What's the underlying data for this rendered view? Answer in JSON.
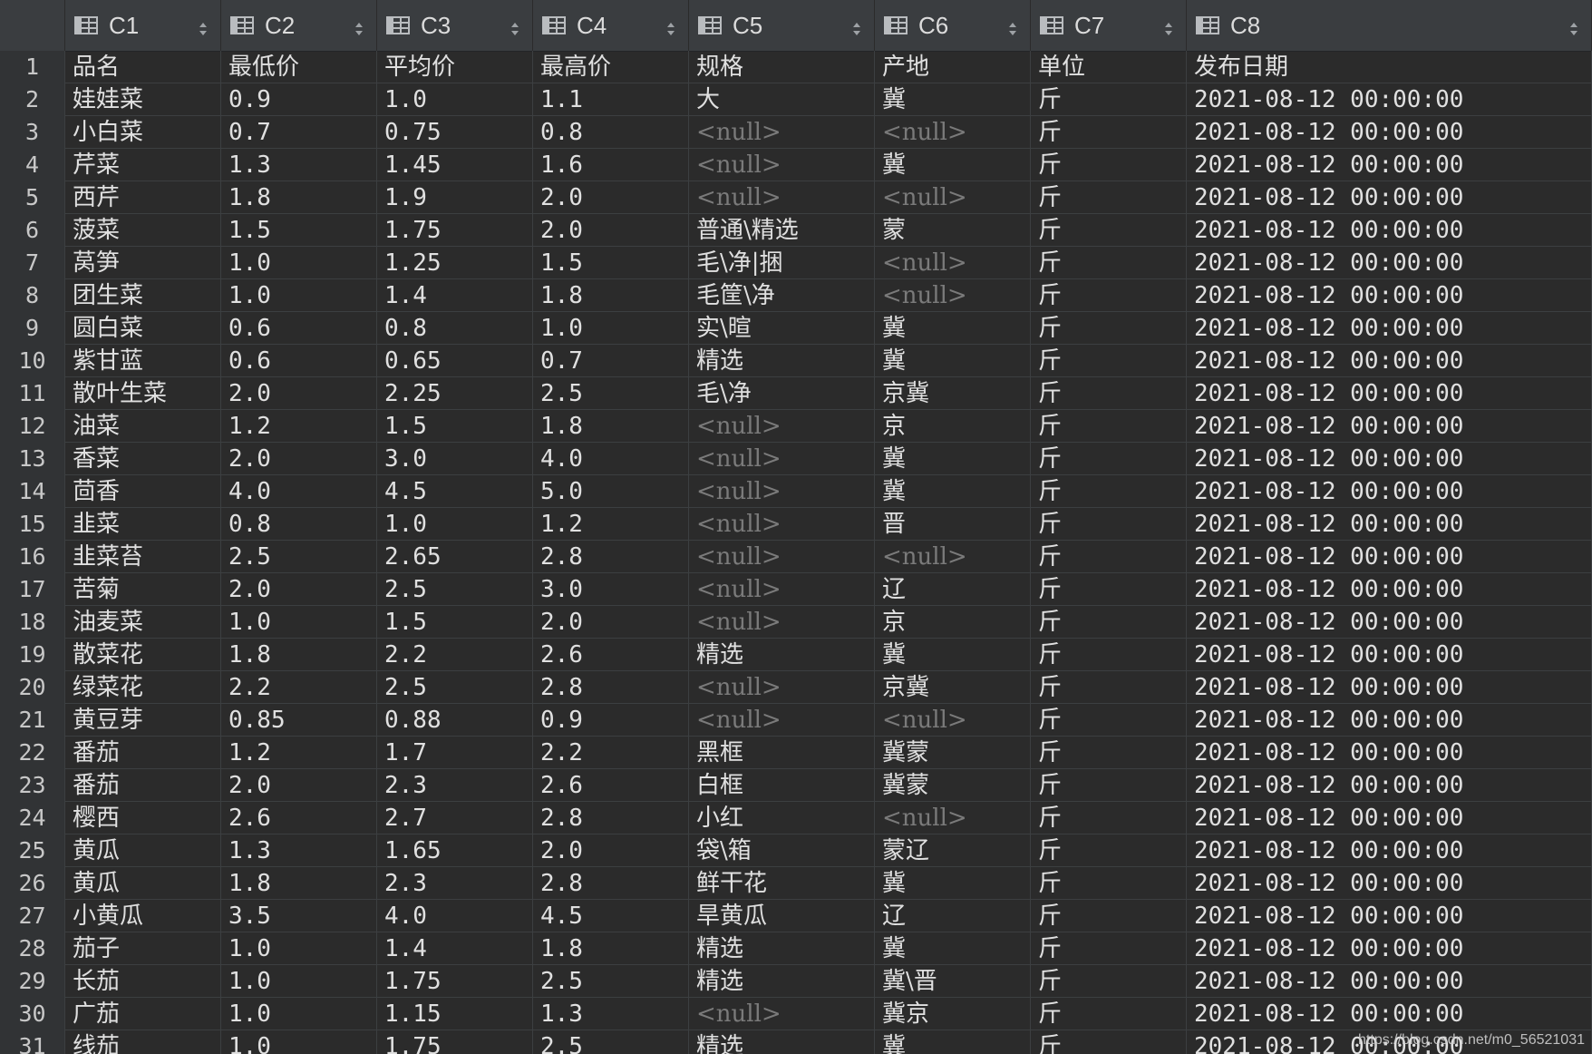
{
  "columns": [
    "C1",
    "C2",
    "C3",
    "C4",
    "C5",
    "C6",
    "C7",
    "C8"
  ],
  "null_text": "<null>",
  "rows": [
    [
      "1",
      "品名",
      "最低价",
      "平均价",
      "最高价",
      "规格",
      "产地",
      "单位",
      "发布日期"
    ],
    [
      "2",
      "娃娃菜",
      "0.9",
      "1.0",
      "1.1",
      "大",
      "冀",
      "斤",
      "2021-08-12 00:00:00"
    ],
    [
      "3",
      "小白菜",
      "0.7",
      "0.75",
      "0.8",
      null,
      null,
      "斤",
      "2021-08-12 00:00:00"
    ],
    [
      "4",
      "芹菜",
      "1.3",
      "1.45",
      "1.6",
      null,
      "冀",
      "斤",
      "2021-08-12 00:00:00"
    ],
    [
      "5",
      "西芹",
      "1.8",
      "1.9",
      "2.0",
      null,
      null,
      "斤",
      "2021-08-12 00:00:00"
    ],
    [
      "6",
      "菠菜",
      "1.5",
      "1.75",
      "2.0",
      "普通\\精选",
      "蒙",
      "斤",
      "2021-08-12 00:00:00"
    ],
    [
      "7",
      "莴笋",
      "1.0",
      "1.25",
      "1.5",
      "毛\\净|捆",
      null,
      "斤",
      "2021-08-12 00:00:00"
    ],
    [
      "8",
      "团生菜",
      "1.0",
      "1.4",
      "1.8",
      "毛筐\\净",
      null,
      "斤",
      "2021-08-12 00:00:00"
    ],
    [
      "9",
      "圆白菜",
      "0.6",
      "0.8",
      "1.0",
      "实\\暄",
      "冀",
      "斤",
      "2021-08-12 00:00:00"
    ],
    [
      "10",
      "紫甘蓝",
      "0.6",
      "0.65",
      "0.7",
      "精选",
      "冀",
      "斤",
      "2021-08-12 00:00:00"
    ],
    [
      "11",
      "散叶生菜",
      "2.0",
      "2.25",
      "2.5",
      "毛\\净",
      "京冀",
      "斤",
      "2021-08-12 00:00:00"
    ],
    [
      "12",
      "油菜",
      "1.2",
      "1.5",
      "1.8",
      null,
      "京",
      "斤",
      "2021-08-12 00:00:00"
    ],
    [
      "13",
      "香菜",
      "2.0",
      "3.0",
      "4.0",
      null,
      "冀",
      "斤",
      "2021-08-12 00:00:00"
    ],
    [
      "14",
      "茴香",
      "4.0",
      "4.5",
      "5.0",
      null,
      "冀",
      "斤",
      "2021-08-12 00:00:00"
    ],
    [
      "15",
      "韭菜",
      "0.8",
      "1.0",
      "1.2",
      null,
      "晋",
      "斤",
      "2021-08-12 00:00:00"
    ],
    [
      "16",
      "韭菜苔",
      "2.5",
      "2.65",
      "2.8",
      null,
      null,
      "斤",
      "2021-08-12 00:00:00"
    ],
    [
      "17",
      "苦菊",
      "2.0",
      "2.5",
      "3.0",
      null,
      "辽",
      "斤",
      "2021-08-12 00:00:00"
    ],
    [
      "18",
      "油麦菜",
      "1.0",
      "1.5",
      "2.0",
      null,
      "京",
      "斤",
      "2021-08-12 00:00:00"
    ],
    [
      "19",
      "散菜花",
      "1.8",
      "2.2",
      "2.6",
      "精选",
      "冀",
      "斤",
      "2021-08-12 00:00:00"
    ],
    [
      "20",
      "绿菜花",
      "2.2",
      "2.5",
      "2.8",
      null,
      "京冀",
      "斤",
      "2021-08-12 00:00:00"
    ],
    [
      "21",
      "黄豆芽",
      "0.85",
      "0.88",
      "0.9",
      null,
      null,
      "斤",
      "2021-08-12 00:00:00"
    ],
    [
      "22",
      "番茄",
      "1.2",
      "1.7",
      "2.2",
      "黑框",
      "冀蒙",
      "斤",
      "2021-08-12 00:00:00"
    ],
    [
      "23",
      "番茄",
      "2.0",
      "2.3",
      "2.6",
      "白框",
      "冀蒙",
      "斤",
      "2021-08-12 00:00:00"
    ],
    [
      "24",
      "樱西",
      "2.6",
      "2.7",
      "2.8",
      "小红",
      null,
      "斤",
      "2021-08-12 00:00:00"
    ],
    [
      "25",
      "黄瓜",
      "1.3",
      "1.65",
      "2.0",
      "袋\\箱",
      "蒙辽",
      "斤",
      "2021-08-12 00:00:00"
    ],
    [
      "26",
      "黄瓜",
      "1.8",
      "2.3",
      "2.8",
      "鲜干花",
      "冀",
      "斤",
      "2021-08-12 00:00:00"
    ],
    [
      "27",
      "小黄瓜",
      "3.5",
      "4.0",
      "4.5",
      "旱黄瓜",
      "辽",
      "斤",
      "2021-08-12 00:00:00"
    ],
    [
      "28",
      "茄子",
      "1.0",
      "1.4",
      "1.8",
      "精选",
      "冀",
      "斤",
      "2021-08-12 00:00:00"
    ],
    [
      "29",
      "长茄",
      "1.0",
      "1.75",
      "2.5",
      "精选",
      "冀\\晋",
      "斤",
      "2021-08-12 00:00:00"
    ],
    [
      "30",
      "广茄",
      "1.0",
      "1.15",
      "1.3",
      null,
      "冀京",
      "斤",
      "2021-08-12 00:00:00"
    ],
    [
      "31",
      "线茄",
      "1.0",
      "1.75",
      "2.5",
      "精选",
      "冀",
      "斤",
      "2021-08-12 00:00:00"
    ]
  ],
  "watermark": "https://blog.csdn.net/m0_56521031",
  "colors": {
    "background": "#2b2b2b",
    "header": "#3a3d40",
    "null_text": "#7a7a7a",
    "text": "#e0e0e0"
  },
  "icons": {
    "column_header": "table-icon",
    "sort": "sort-arrows-icon"
  }
}
